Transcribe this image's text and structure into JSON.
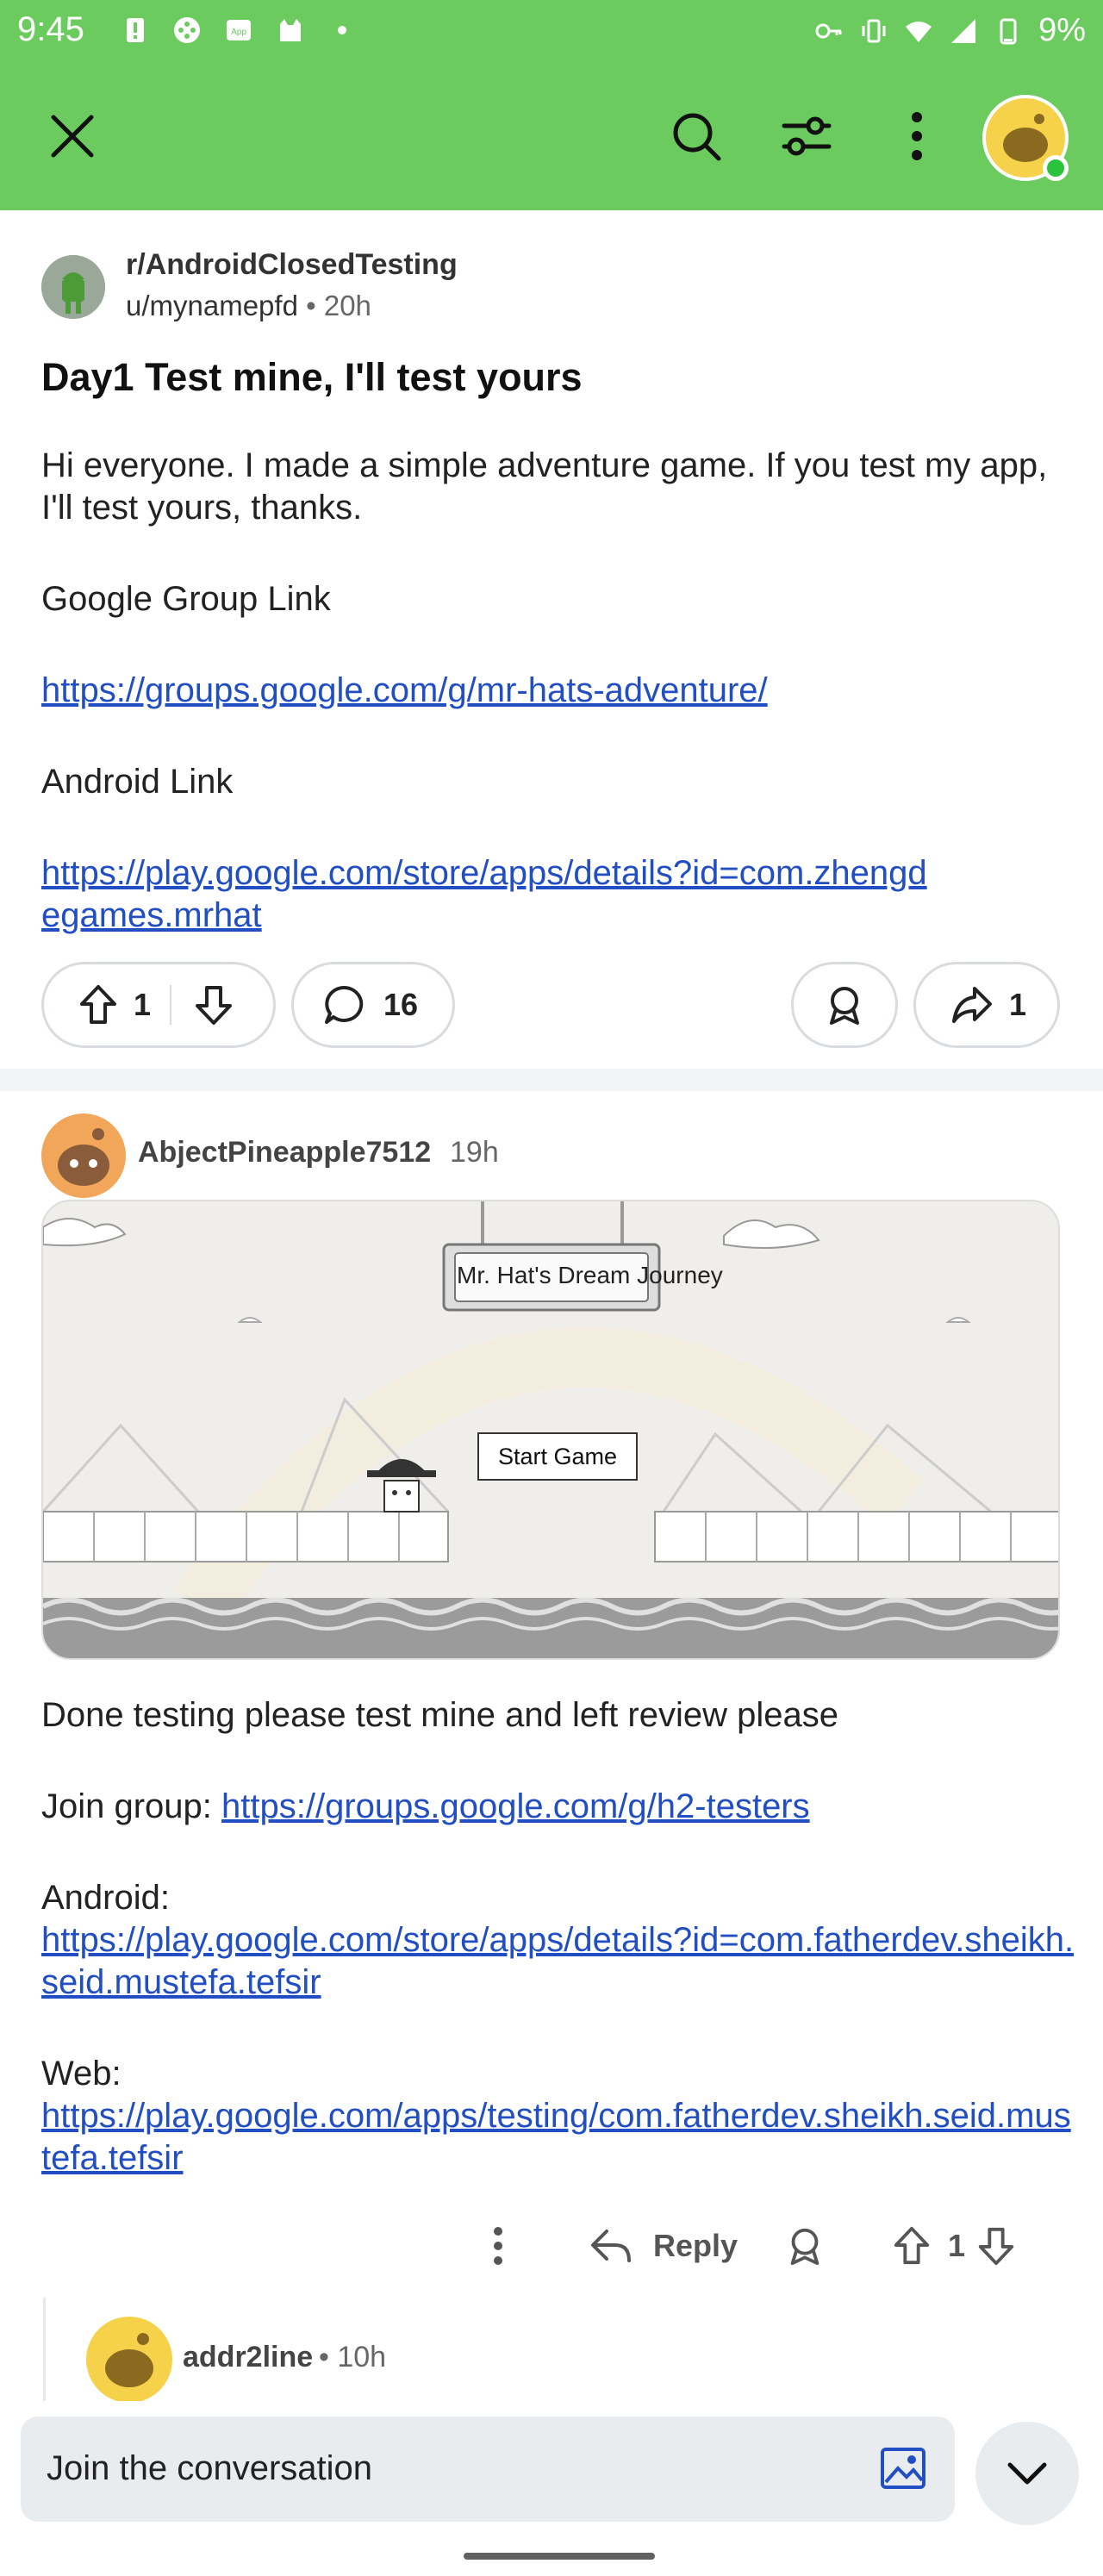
{
  "status": {
    "time": "9:45",
    "battery": "9%",
    "left_icons": [
      "alert-icon",
      "game-controller-icon",
      "app-icon",
      "cat-icon",
      "dot-icon"
    ],
    "right_icons": [
      "key-icon",
      "vibrate-icon",
      "wifi-icon",
      "signal-icon",
      "battery-icon"
    ]
  },
  "appbar": {
    "close_icon": "close-icon",
    "search_icon": "search-icon",
    "sort_icon": "sort-icon",
    "more_icon": "more-vertical-icon",
    "accent": "#6ccb5f"
  },
  "post": {
    "subreddit": "r/AndroidClosedTesting",
    "author": "u/mynamepfd",
    "separator": "•",
    "time": "20h",
    "title": "Day1 Test mine, I'll test yours",
    "body": {
      "intro": "Hi everyone. I made a simple adventure game. If you test my app, I'll test yours, thanks.",
      "group_label": "Google Group Link",
      "group_link": "https://groups.google.com/g/mr-hats-adventure/",
      "android_label": "Android Link",
      "android_link": "https://play.google.com/store/apps/details?id=com.zhengdegames.mrhat"
    },
    "votes": "1",
    "comments": "16",
    "shares": "1"
  },
  "comment": {
    "author": "AbjectPineapple7512",
    "time": "19h",
    "game": {
      "title": "Mr. Hat's Dream Journey",
      "start_button": "Start Game"
    },
    "body": {
      "line1": "Done testing please test mine and left review please",
      "join_label": "Join group: ",
      "join_link": "https://groups.google.com/g/h2-testers",
      "android_label": "Android:",
      "android_link": "https://play.google.com/store/apps/details?id=com.fatherdev.sheikh.seid.mustefa.tefsir",
      "web_label": "Web:",
      "web_link": "https://play.google.com/apps/testing/com.fatherdev.sheikh.seid.mustefa.tefsir"
    },
    "reply_label": "Reply",
    "votes": "1"
  },
  "reply": {
    "author": "addr2line",
    "separator": "•",
    "time": "10h"
  },
  "composer": {
    "placeholder": "Join the conversation"
  }
}
